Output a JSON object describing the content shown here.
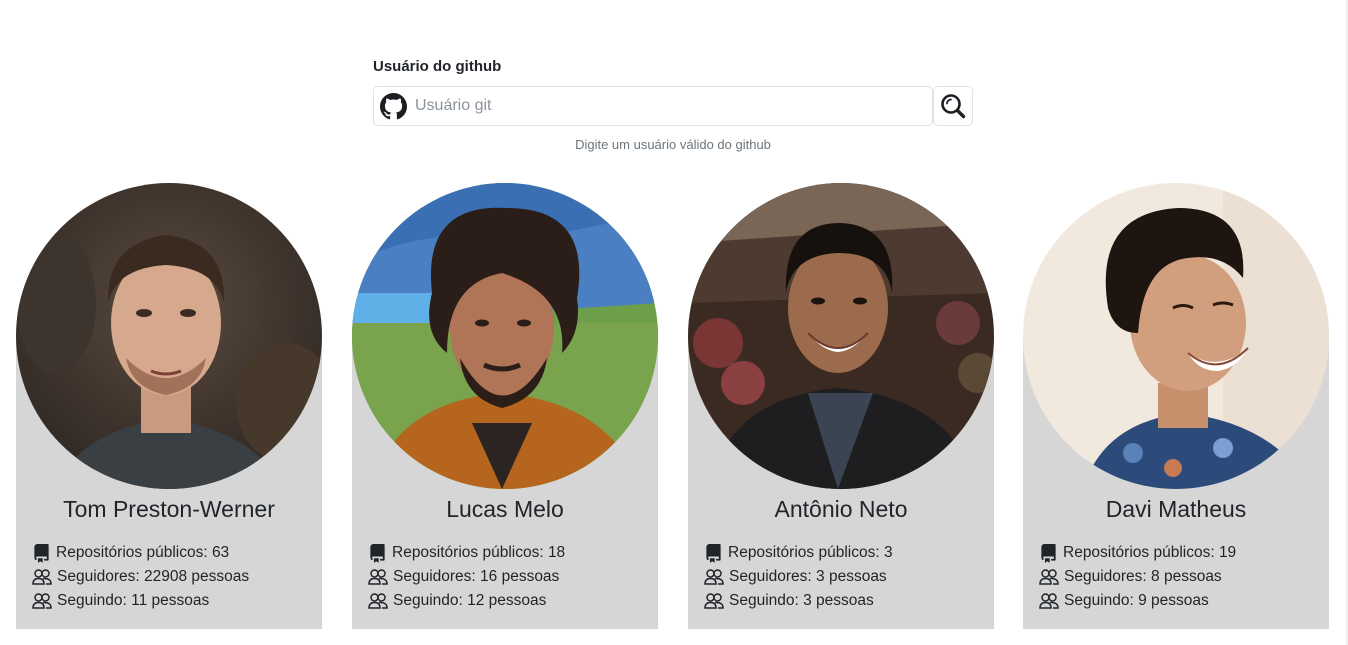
{
  "search": {
    "label": "Usuário do github",
    "placeholder": "Usuário git",
    "value": "",
    "hint": "Digite um usuário válido do github"
  },
  "cards": [
    {
      "name": "Tom Preston-Werner",
      "repos": "Repositórios públicos: 63",
      "followers": "Seguidores: 22908 pessoas",
      "following": "Seguindo: 11 pessoas"
    },
    {
      "name": "Lucas Melo",
      "repos": "Repositórios públicos: 18",
      "followers": "Seguidores: 16 pessoas",
      "following": "Seguindo: 12 pessoas"
    },
    {
      "name": "Antônio Neto",
      "repos": "Repositórios públicos: 3",
      "followers": "Seguidores: 3 pessoas",
      "following": "Seguindo: 3 pessoas"
    },
    {
      "name": "Davi Matheus",
      "repos": "Repositórios públicos: 19",
      "followers": "Seguidores: 8 pessoas",
      "following": "Seguindo: 9 pessoas"
    }
  ],
  "icons": {
    "input": "github-icon",
    "button": "search-icon",
    "repos": "repo-icon",
    "followers": "people-icon",
    "following": "people-icon"
  },
  "colors": {
    "card_bg": "#d6d6d6",
    "border": "#dee2e6",
    "hint": "#6c757d"
  }
}
